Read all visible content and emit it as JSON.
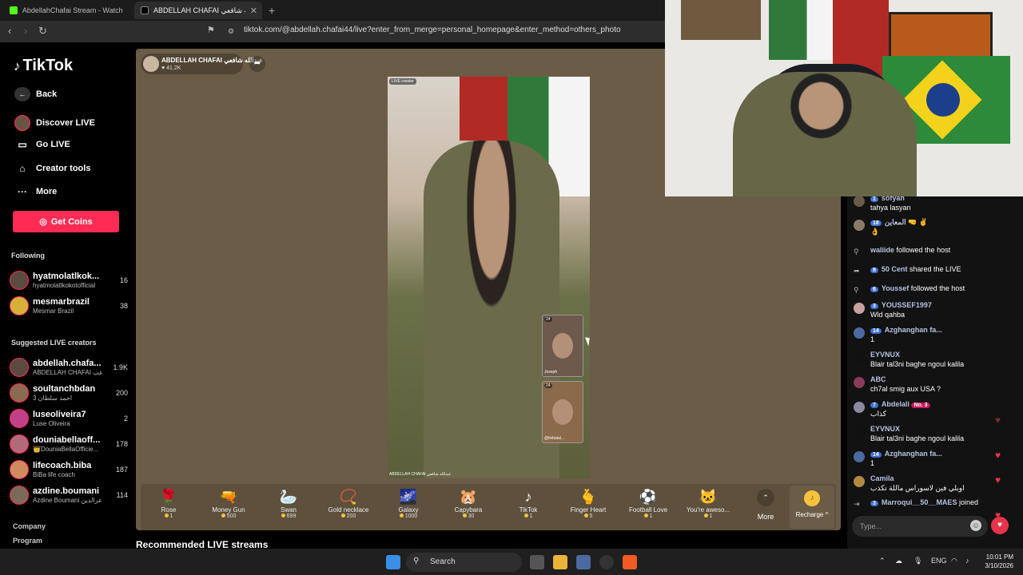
{
  "browser": {
    "tabs": [
      {
        "title": "AbdellahChafai Stream - Watch Live"
      },
      {
        "title": "ABDELLAH CHAFAI عبدالله شافعي"
      }
    ],
    "url": "tiktok.com/@abdellah.chafai44/live?enter_from_merge=personal_homepage&enter_method=others_photo"
  },
  "sidebar": {
    "logo": "TikTok",
    "menu": [
      {
        "label": "Back",
        "icon": "back-arrow-icon"
      },
      {
        "label": "Discover LIVE",
        "icon": "live-avatar-icon"
      },
      {
        "label": "Go LIVE",
        "icon": "camera-icon"
      },
      {
        "label": "Creator tools",
        "icon": "home-icon"
      },
      {
        "label": "More",
        "icon": "ellipsis-icon"
      }
    ],
    "get_coins": "Get Coins",
    "following_title": "Following",
    "following": [
      {
        "name": "hyatmolatlkok...",
        "sub": "hyatmolatlkokotofficial",
        "count": "16"
      },
      {
        "name": "mesmarbrazil",
        "sub": "Mesmar Brazil",
        "count": "38"
      }
    ],
    "suggested_title": "Suggested LIVE creators",
    "suggested": [
      {
        "name": "abdellah.chafa...",
        "sub": "ABDELLAH CHAFAI عب",
        "count": "1.9K"
      },
      {
        "name": "soultanchbdan",
        "sub": "احمد سلطان 3",
        "count": "200"
      },
      {
        "name": "luseoliveira7",
        "sub": "Luse Oliveira",
        "count": "2"
      },
      {
        "name": "douniabellaoff...",
        "sub": "👑DouniaBellaOfficie...",
        "count": "178"
      },
      {
        "name": "lifecoach.biba",
        "sub": "BiBa life coach",
        "count": "187"
      },
      {
        "name": "azdine.boumani",
        "sub": "Azdine Boumani عزالدين",
        "count": "114"
      }
    ],
    "footer": [
      "Company",
      "Program"
    ]
  },
  "stream": {
    "host_name": "ABDELLAH CHAFAI عبدالله شافعي",
    "likes": "41.2K",
    "video_label": "LIVE creator",
    "video_name": "ABDELLAH CHAFAI عبدالله شافعي",
    "guests": [
      {
        "name": "Joseph",
        "badge": "24"
      },
      {
        "name": "@tivbatal...",
        "badge": "24"
      }
    ]
  },
  "gifts": [
    {
      "name": "Rose",
      "price": "1",
      "icon": "🌹"
    },
    {
      "name": "Money Gun",
      "price": "500",
      "icon": "🔫"
    },
    {
      "name": "Swan",
      "price": "699",
      "icon": "🦢"
    },
    {
      "name": "Gold necklace",
      "price": "200",
      "icon": "📿"
    },
    {
      "name": "Galaxy",
      "price": "1000",
      "icon": "🌌"
    },
    {
      "name": "Capybara",
      "price": "30",
      "icon": "🐹"
    },
    {
      "name": "TikTok",
      "price": "1",
      "icon": "♪"
    },
    {
      "name": "Finger Heart",
      "price": "5",
      "icon": "🫰"
    },
    {
      "name": "Football Love",
      "price": "1",
      "icon": "⚽"
    },
    {
      "name": "You're aweso...",
      "price": "1",
      "icon": "🐱"
    }
  ],
  "gifts_more": "More",
  "recharge": "Recharge ^",
  "recommended": "Recommended LIVE streams",
  "chat": [
    {
      "user": "sofyan",
      "level": "1",
      "text": "tahya lasyan"
    },
    {
      "user": "المعاين 🤜 ✌️",
      "level": "18",
      "text": "👌"
    },
    {
      "user": "waliide",
      "level": "",
      "action": "followed the host"
    },
    {
      "user": "50 Cent",
      "level": "8",
      "action": "shared the LIVE"
    },
    {
      "user": "Youssef",
      "level": "6",
      "action": "followed the host"
    },
    {
      "user": "YOUSSEF1997",
      "level": "3",
      "text": "Wld qahba"
    },
    {
      "user": "Azghanghan fa...",
      "level": "14",
      "text": "1"
    },
    {
      "user": "EYVNUX",
      "level": "",
      "text": "Blair tal3ni baghe ngoul kalila"
    },
    {
      "user": "ABC",
      "level": "",
      "text": "ch7al smig aux USA ?"
    },
    {
      "user": "Abdelali",
      "level": "7",
      "badge": "No. 3",
      "text": "كذاب"
    },
    {
      "user": "EYVNUX",
      "level": "",
      "text": "Blair tal3ni baghe ngoul kalila"
    },
    {
      "user": "Azghanghan fa...",
      "level": "14",
      "text": "1"
    },
    {
      "user": "Camila",
      "level": "",
      "text": "اوبلي فين لاسوراس ماللة تكذب"
    },
    {
      "user": "Marroqui__50__MAES",
      "level": "3",
      "action": "joined"
    }
  ],
  "chat_input_placeholder": "Type...",
  "taskbar": {
    "search": "Search",
    "lang": "ENG",
    "time": "10:01 PM",
    "date": "3/10/2026"
  }
}
